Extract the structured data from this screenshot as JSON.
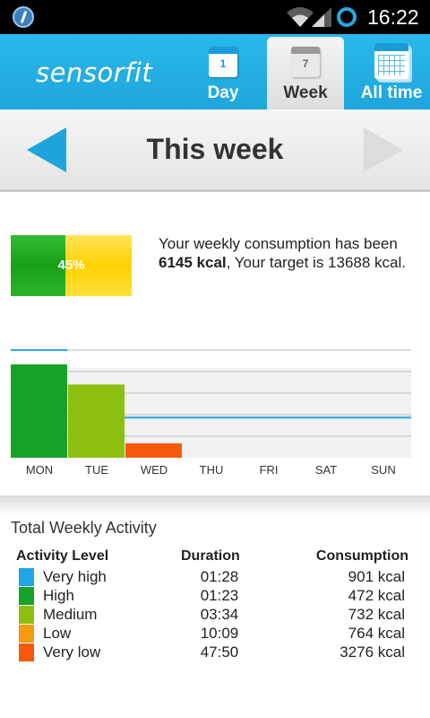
{
  "status_bar": {
    "time": "16:22",
    "icons": [
      "app-icon",
      "wifi-icon",
      "signal-icon",
      "sync-icon"
    ]
  },
  "app": {
    "logo": "sensorfit"
  },
  "tabs": [
    {
      "label": "Day",
      "icon": "calendar-day-icon",
      "icon_text": "1",
      "selected": false
    },
    {
      "label": "Week",
      "icon": "calendar-week-icon",
      "icon_text": "7",
      "selected": true
    },
    {
      "label": "All time",
      "icon": "calendar-all-icon",
      "selected": false
    }
  ],
  "navigator": {
    "title": "This week"
  },
  "summary": {
    "percent": "45%",
    "progress_fraction": 0.45,
    "line1": "Your weekly consumption has been",
    "consumption": "6145 kcal",
    "line2": ", Your target is 13688 kcal."
  },
  "chart_data": {
    "type": "bar",
    "categories": [
      "MON",
      "TUE",
      "WED",
      "THU",
      "FRI",
      "SAT",
      "SUN"
    ],
    "values": [
      6500,
      5100,
      1000,
      0,
      0,
      0,
      0
    ],
    "colors": [
      "#16a32a",
      "#8cbf10",
      "#f55a0c",
      "#cccccc",
      "#cccccc",
      "#cccccc",
      "#cccccc"
    ],
    "ylim": [
      0,
      7500
    ],
    "grid": true,
    "target_line": 2800,
    "target_color": "#2aa7e3"
  },
  "activity": {
    "title": "Total Weekly Activity",
    "headers": {
      "level": "Activity Level",
      "duration": "Duration",
      "consumption": "Consumption"
    },
    "rows": [
      {
        "name": "Very high",
        "duration": "01:28",
        "kcal": "901 kcal",
        "color": "#1ea6e6"
      },
      {
        "name": "High",
        "duration": "01:23",
        "kcal": "472 kcal",
        "color": "#16a32a"
      },
      {
        "name": "Medium",
        "duration": "03:34",
        "kcal": "732 kcal",
        "color": "#8cbf10"
      },
      {
        "name": "Low",
        "duration": "10:09",
        "kcal": "764 kcal",
        "color": "#f59a10"
      },
      {
        "name": "Very low",
        "duration": "47:50",
        "kcal": "3276 kcal",
        "color": "#f55a0c"
      }
    ]
  }
}
